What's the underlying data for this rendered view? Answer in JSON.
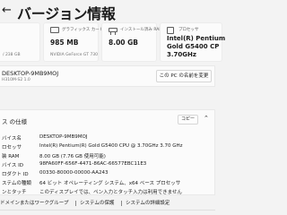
{
  "header": {
    "back_glyph": "←",
    "title": "バージョン情報"
  },
  "cards": [
    {
      "sub": "/ 238 GB"
    },
    {
      "head": "グラフィックス カード",
      "value": "985 MB",
      "sub": "NVIDIA GeForce GT 730"
    },
    {
      "head": "インストール済み RAM",
      "value": "8.00 GB"
    },
    {
      "head": "プロセッサ",
      "value_lines": [
        "Intel(R) Pentium",
        "Gold G5400 CP",
        "3.70GHz"
      ]
    }
  ],
  "device": {
    "name": "DESKTOP-9MB9MOJ",
    "model": "H310M-S2 1.0",
    "rename_label": "この PC の名前を変更"
  },
  "specs": {
    "section_title": "ス の仕様",
    "copy_label": "コピー",
    "rows": [
      {
        "label": "バイス名",
        "value": "DESKTOP-9MB9MOJ"
      },
      {
        "label": "ロセッサ",
        "value": "Intel(R) Pentium(R) Gold G5400 CPU @ 3.70GHz   3.70 GHz"
      },
      {
        "label": "装 RAM",
        "value": "8.00 GB (7.76 GB 使用可能)"
      },
      {
        "label": "バイス ID",
        "value": "98FA60FF-656F-4471-86AC-66577EBC11E3"
      },
      {
        "label": "ロダクト ID",
        "value": "00330-80000-00000-AA243"
      },
      {
        "label": "ステムの種類",
        "value": "64 ビット オペレーティング システム、x64 ベース プロセッサ"
      },
      {
        "label": "ンとタッチ",
        "value": "このディスプレイでは、ペン入力とタッチ入力は利用できません"
      }
    ]
  },
  "links": {
    "domain": "ドメインまたはワークグループ",
    "protection": "システムの保護",
    "advanced": "システムの詳細設定"
  }
}
